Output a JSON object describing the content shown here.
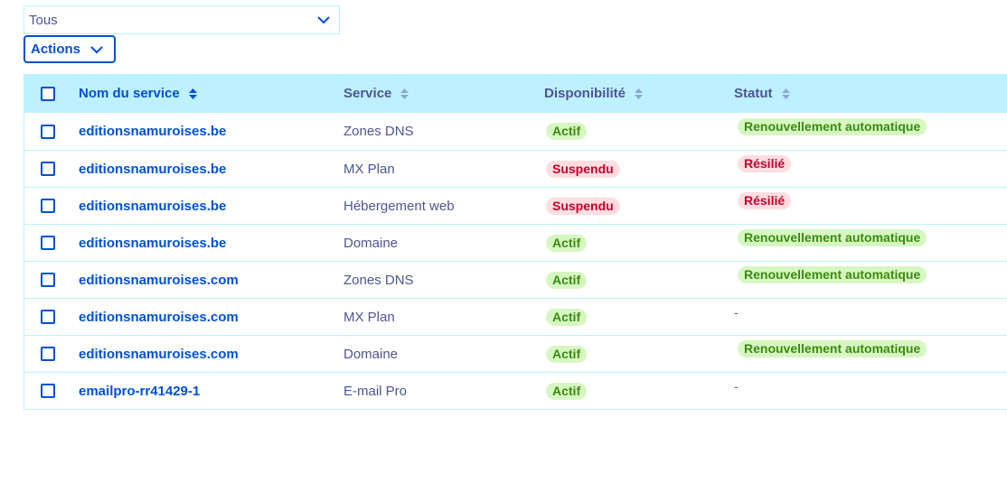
{
  "filter": {
    "value": "Tous"
  },
  "actions": {
    "label": "Actions"
  },
  "table": {
    "headers": {
      "name": "Nom du service",
      "service": "Service",
      "dispo": "Disponibilité",
      "statut": "Statut"
    },
    "rows": [
      {
        "name": "editionsnamuroises.be",
        "service": "Zones DNS",
        "dispo": "Actif",
        "dispo_color": "green",
        "statut": "Renouvellement automatique",
        "statut_color": "green"
      },
      {
        "name": "editionsnamuroises.be",
        "service": "MX Plan",
        "dispo": "Suspendu",
        "dispo_color": "red",
        "statut": "Résilié",
        "statut_color": "red"
      },
      {
        "name": "editionsnamuroises.be",
        "service": "Hébergement web",
        "dispo": "Suspendu",
        "dispo_color": "red",
        "statut": "Résilié",
        "statut_color": "red"
      },
      {
        "name": "editionsnamuroises.be",
        "service": "Domaine",
        "dispo": "Actif",
        "dispo_color": "green",
        "statut": "Renouvellement automatique",
        "statut_color": "green"
      },
      {
        "name": "editionsnamuroises.com",
        "service": "Zones DNS",
        "dispo": "Actif",
        "dispo_color": "green",
        "statut": "Renouvellement automatique",
        "statut_color": "green"
      },
      {
        "name": "editionsnamuroises.com",
        "service": "MX Plan",
        "dispo": "Actif",
        "dispo_color": "green",
        "statut": "-",
        "statut_color": "none"
      },
      {
        "name": "editionsnamuroises.com",
        "service": "Domaine",
        "dispo": "Actif",
        "dispo_color": "green",
        "statut": "Renouvellement automatique",
        "statut_color": "green"
      },
      {
        "name": "emailpro-rr41429-1",
        "service": "E-mail Pro",
        "dispo": "Actif",
        "dispo_color": "green",
        "statut": "-",
        "statut_color": "none"
      }
    ]
  },
  "colors": {
    "primary": "#0050d7",
    "header_bg": "#bef1ff",
    "text": "#4d5592",
    "badge_green_bg": "#d7f7c2",
    "badge_green_text": "#3b8a0f",
    "badge_red_bg": "#ffdde0",
    "badge_red_text": "#c4002c"
  }
}
